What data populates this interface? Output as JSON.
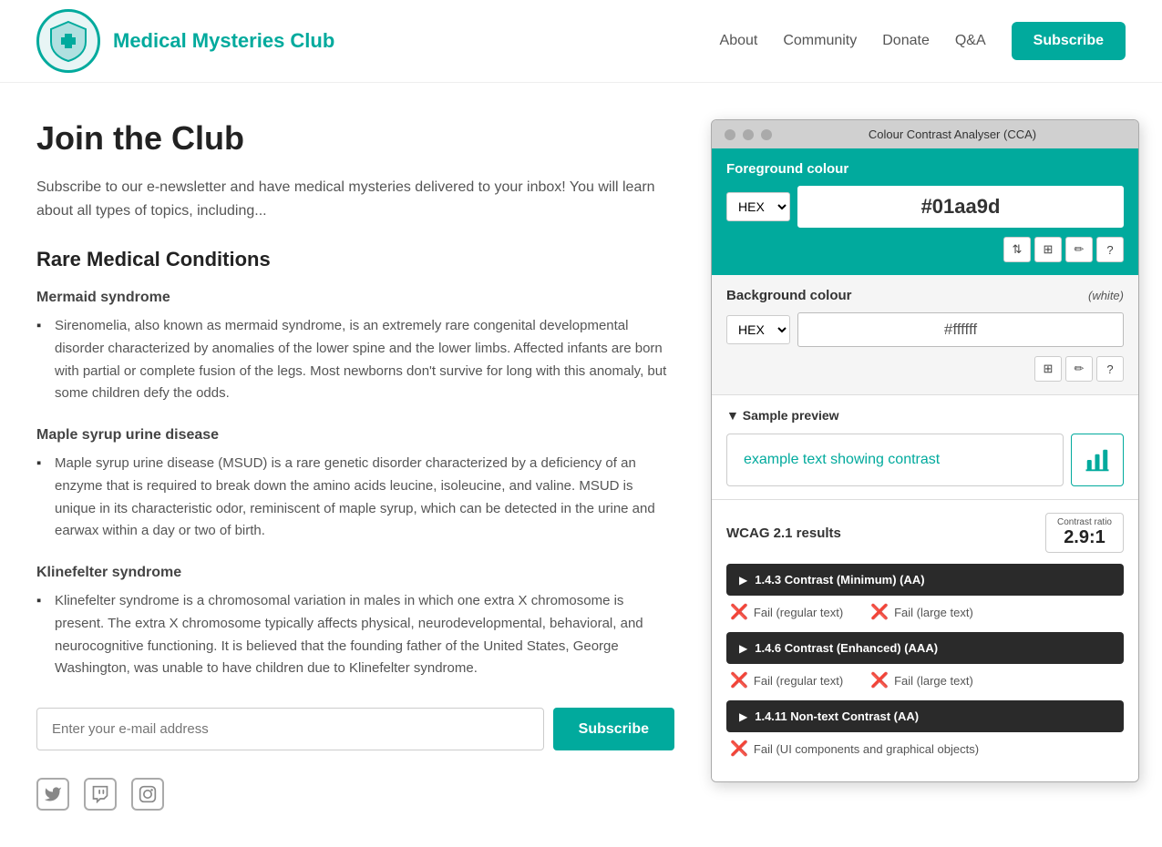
{
  "header": {
    "site_title": "Medical Mysteries Club",
    "nav": {
      "about": "About",
      "community": "Community",
      "donate": "Donate",
      "qa": "Q&A",
      "subscribe": "Subscribe"
    }
  },
  "content": {
    "page_heading": "Join the Club",
    "intro": "Subscribe to our e-newsletter and have medical mysteries delivered to your inbox! You will learn about all types of topics, including...",
    "section_heading": "Rare Medical Conditions",
    "conditions": [
      {
        "title": "Mermaid syndrome",
        "description": "Sirenomelia, also known as mermaid syndrome, is an extremely rare congenital developmental disorder characterized by anomalies of the lower spine and the lower limbs. Affected infants are born with partial or complete fusion of the legs. Most newborns don't survive for long with this anomaly, but some children defy the odds."
      },
      {
        "title": "Maple syrup urine disease",
        "description": "Maple syrup urine disease (MSUD) is a rare genetic disorder characterized by a deficiency of an enzyme that is required to break down the amino acids leucine, isoleucine, and valine. MSUD is unique in its characteristic odor, reminiscent of maple syrup, which can be detected in the urine and earwax within a day or two of birth."
      },
      {
        "title": "Klinefelter syndrome",
        "description": "Klinefelter syndrome is a chromosomal variation in males in which one extra X chromosome is present. The extra X chromosome typically affects physical, neurodevelopmental, behavioral, and neurocognitive functioning. It is believed that the founding father of the United States, George Washington, was unable to have children due to Klinefelter syndrome."
      }
    ],
    "email_placeholder": "Enter your e-mail address",
    "subscribe_btn": "Subscribe"
  },
  "cca": {
    "title": "Colour Contrast Analyser (CCA)",
    "fg_label": "Foreground colour",
    "fg_format": "HEX",
    "fg_value": "#01aa9d",
    "bg_label": "Background colour",
    "bg_note": "(white)",
    "bg_format": "HEX",
    "bg_value": "#ffffff",
    "preview_header": "▼ Sample preview",
    "preview_text": "example text showing contrast",
    "wcag_label": "WCAG 2.1 results",
    "contrast_ratio_label": "Contrast ratio",
    "contrast_ratio_value": "2.9:1",
    "criteria": [
      {
        "id": "1.4.3",
        "label": "1.4.3 Contrast (Minimum) (AA)",
        "results": [
          {
            "status": "fail",
            "text": "Fail (regular text)"
          },
          {
            "status": "fail",
            "text": "Fail (large text)"
          }
        ]
      },
      {
        "id": "1.4.6",
        "label": "1.4.6 Contrast (Enhanced) (AAA)",
        "results": [
          {
            "status": "fail",
            "text": "Fail (regular text)"
          },
          {
            "status": "fail",
            "text": "Fail (large text)"
          }
        ]
      },
      {
        "id": "1.4.11",
        "label": "1.4.11 Non-text Contrast (AA)",
        "results": [
          {
            "status": "fail",
            "text": "Fail (UI components and graphical objects)"
          }
        ]
      }
    ]
  }
}
